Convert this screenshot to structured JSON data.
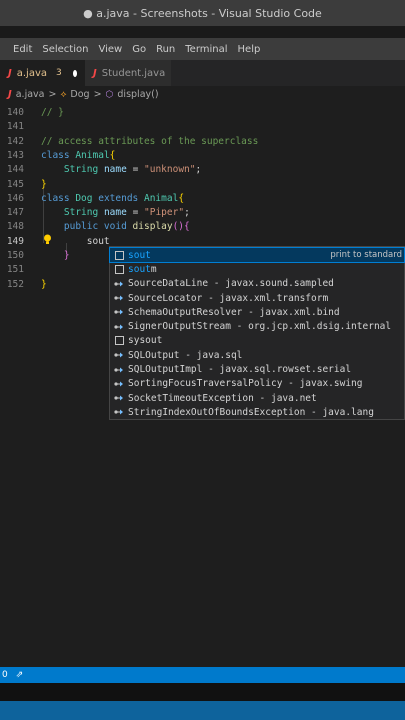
{
  "window": {
    "title": "● a.java - Screenshots - Visual Studio Code"
  },
  "menu": [
    "Edit",
    "Selection",
    "View",
    "Go",
    "Run",
    "Terminal",
    "Help"
  ],
  "tabs": [
    {
      "label": "a.java",
      "modified_count": "3",
      "icon": "java-icon"
    },
    {
      "label": "Student.java",
      "icon": "java-icon"
    }
  ],
  "breadcrumb": {
    "file": "a.java",
    "sep": ">",
    "class": "Dog",
    "method": "display()"
  },
  "editor": {
    "lines": [
      {
        "n": "140",
        "tokens": [
          [
            "cm",
            "// }"
          ]
        ]
      },
      {
        "n": "141",
        "tokens": []
      },
      {
        "n": "142",
        "tokens": [
          [
            "cm",
            "// access attributes of the superclass"
          ]
        ]
      },
      {
        "n": "143",
        "tokens": [
          [
            "kw",
            "class "
          ],
          [
            "ty",
            "Animal"
          ],
          [
            "br",
            "{"
          ]
        ]
      },
      {
        "n": "144",
        "tokens": [
          [
            "pn",
            "    "
          ],
          [
            "ty",
            "String"
          ],
          [
            "pn",
            " "
          ],
          [
            "vr",
            "name"
          ],
          [
            "pn",
            " = "
          ],
          [
            "st",
            "\"unknown\""
          ],
          [
            "pn",
            ";"
          ]
        ]
      },
      {
        "n": "145",
        "tokens": [
          [
            "br",
            "}"
          ]
        ]
      },
      {
        "n": "146",
        "tokens": [
          [
            "kw",
            "class "
          ],
          [
            "ty",
            "Dog"
          ],
          [
            "kw",
            " extends "
          ],
          [
            "ty",
            "Animal"
          ],
          [
            "br",
            "{"
          ]
        ]
      },
      {
        "n": "147",
        "tokens": [
          [
            "pn",
            "    "
          ],
          [
            "ty",
            "String"
          ],
          [
            "pn",
            " "
          ],
          [
            "vr",
            "name"
          ],
          [
            "pn",
            " = "
          ],
          [
            "st",
            "\"Piper\""
          ],
          [
            "pn",
            ";"
          ]
        ]
      },
      {
        "n": "148",
        "tokens": [
          [
            "pn",
            "    "
          ],
          [
            "kw",
            "public void "
          ],
          [
            "fn",
            "display"
          ],
          [
            "br2",
            "()"
          ],
          [
            "br2",
            "{"
          ]
        ]
      },
      {
        "n": "149",
        "tokens": [
          [
            "pn",
            "        sout"
          ]
        ]
      },
      {
        "n": "150",
        "tokens": [
          [
            "pn",
            "    "
          ],
          [
            "br2",
            "}"
          ]
        ]
      },
      {
        "n": "151",
        "tokens": []
      },
      {
        "n": "152",
        "tokens": [
          [
            "br",
            "}"
          ]
        ]
      }
    ]
  },
  "suggestions": {
    "detail": "print to standard",
    "items": [
      {
        "kind": "snippet",
        "match": "sout",
        "rest": ""
      },
      {
        "kind": "snippet",
        "match": "sout",
        "rest": "m"
      },
      {
        "kind": "class",
        "text": "SourceDataLine - javax.sound.sampled"
      },
      {
        "kind": "class",
        "text": "SourceLocator - javax.xml.transform"
      },
      {
        "kind": "class",
        "text": "SchemaOutputResolver - javax.xml.bind"
      },
      {
        "kind": "class",
        "text": "SignerOutputStream - org.jcp.xml.dsig.internal"
      },
      {
        "kind": "snippet",
        "match": "",
        "rest": "sysout"
      },
      {
        "kind": "class",
        "text": "SQLOutput - java.sql"
      },
      {
        "kind": "class",
        "text": "SQLOutputImpl - javax.sql.rowset.serial"
      },
      {
        "kind": "class",
        "text": "SortingFocusTraversalPolicy - javax.swing"
      },
      {
        "kind": "class",
        "text": "SocketTimeoutException - java.net"
      },
      {
        "kind": "class",
        "text": "StringIndexOutOfBoundsException - java.lang"
      }
    ]
  },
  "status": {
    "errors": "0"
  },
  "colors": {
    "accent": "#007acc",
    "selection": "#04395e",
    "match": "#18a3ff"
  }
}
